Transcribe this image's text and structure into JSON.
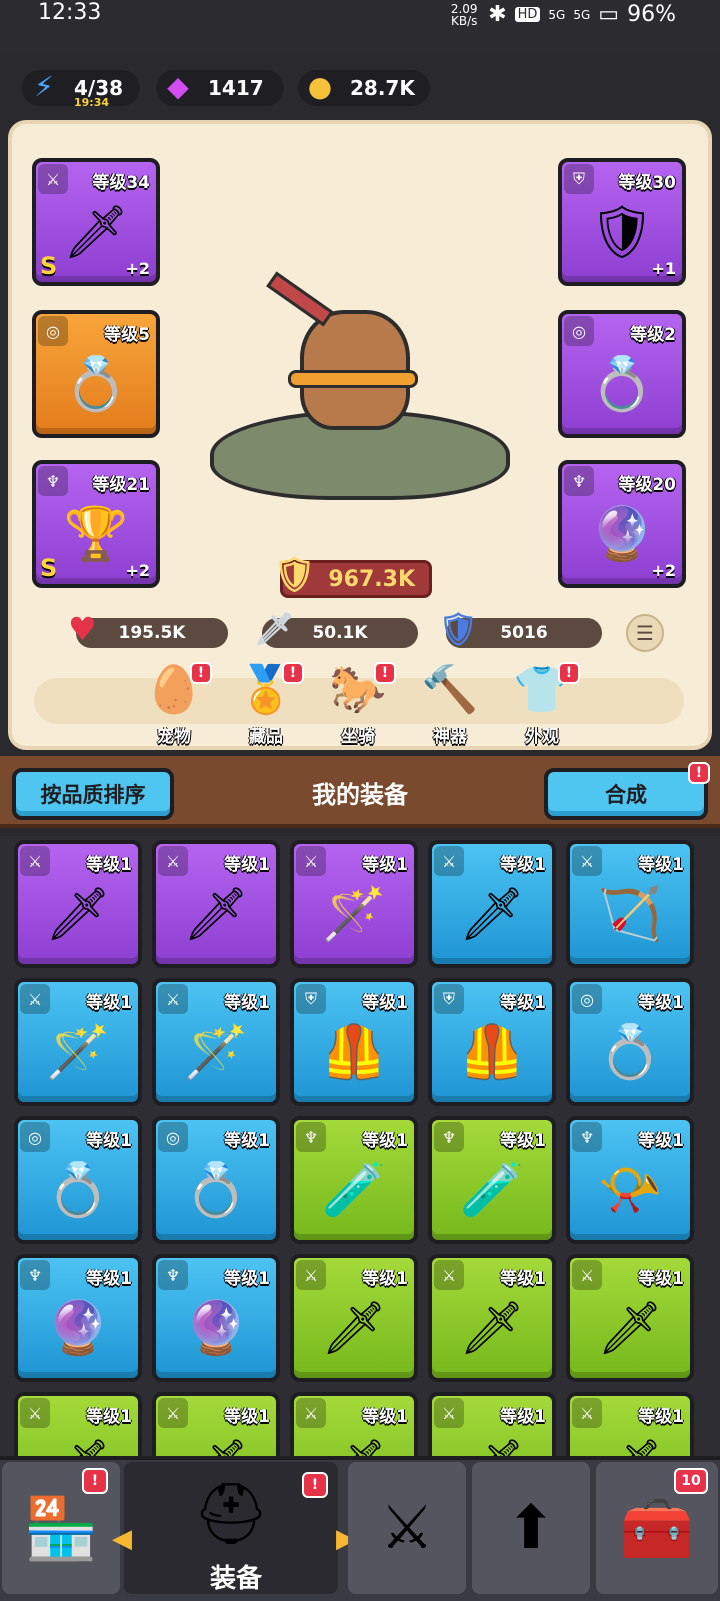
{
  "status_bar": {
    "time": "12:33",
    "net_speed": "2.09 KB/s",
    "signal_1": "5G",
    "signal_2": "5G",
    "battery": "96%"
  },
  "resources": {
    "energy": {
      "value": "4/38",
      "timer": "19:34",
      "icon": "lightning-icon"
    },
    "gems": {
      "value": "1417",
      "icon": "gem-icon"
    },
    "coins": {
      "value": "28.7K",
      "icon": "coin-icon"
    }
  },
  "equipped": [
    {
      "slot": "weapon",
      "level": "等级34",
      "plus": "+2",
      "grade": "S",
      "rarity": "purple",
      "icon": "sword-icon"
    },
    {
      "slot": "armor",
      "level": "等级30",
      "plus": "+1",
      "grade": "",
      "rarity": "purple",
      "icon": "armor-icon"
    },
    {
      "slot": "ring",
      "level": "等级5",
      "plus": "",
      "grade": "",
      "rarity": "orange",
      "icon": "ring-icon"
    },
    {
      "slot": "ring",
      "level": "等级2",
      "plus": "",
      "grade": "",
      "rarity": "purple",
      "icon": "ring-icon"
    },
    {
      "slot": "necklace",
      "level": "等级21",
      "plus": "+2",
      "grade": "S",
      "rarity": "purple",
      "icon": "chalice-icon"
    },
    {
      "slot": "necklace",
      "level": "等级20",
      "plus": "+2",
      "grade": "",
      "rarity": "purple",
      "icon": "orb-icon"
    }
  ],
  "power": "967.3K",
  "stats": {
    "hp": "195.5K",
    "attack": "50.1K",
    "defense": "5016"
  },
  "sub_tabs": [
    {
      "label": "宠物",
      "icon": "pet-egg-icon",
      "badge": "!"
    },
    {
      "label": "藏品",
      "icon": "collection-icon",
      "badge": "!"
    },
    {
      "label": "坐骑",
      "icon": "mount-icon",
      "badge": "!"
    },
    {
      "label": "神器",
      "icon": "hammer-icon",
      "badge": ""
    },
    {
      "label": "外观",
      "icon": "outfit-icon",
      "badge": "!"
    }
  ],
  "equipment_bar": {
    "sort_label": "按品质排序",
    "title": "我的装备",
    "merge_label": "合成",
    "merge_badge": "!"
  },
  "inventory": [
    {
      "level": "等级1",
      "rarity": "purple",
      "icon": "sword-icon",
      "tag": "sword"
    },
    {
      "level": "等级1",
      "rarity": "purple",
      "icon": "sword-icon",
      "tag": "sword"
    },
    {
      "level": "等级1",
      "rarity": "purple",
      "icon": "staff-icon",
      "tag": "sword"
    },
    {
      "level": "等级1",
      "rarity": "blue",
      "icon": "sword-icon",
      "tag": "sword"
    },
    {
      "level": "等级1",
      "rarity": "blue",
      "icon": "bow-icon",
      "tag": "sword"
    },
    {
      "level": "等级1",
      "rarity": "blue",
      "icon": "staff-icon",
      "tag": "sword"
    },
    {
      "level": "等级1",
      "rarity": "blue",
      "icon": "wand-icon",
      "tag": "sword"
    },
    {
      "level": "等级1",
      "rarity": "blue",
      "icon": "armor-icon",
      "tag": "armor"
    },
    {
      "level": "等级1",
      "rarity": "blue",
      "icon": "armor-icon",
      "tag": "armor"
    },
    {
      "level": "等级1",
      "rarity": "blue",
      "icon": "ring-icon",
      "tag": "ring"
    },
    {
      "level": "等级1",
      "rarity": "blue",
      "icon": "ring-icon",
      "tag": "ring"
    },
    {
      "level": "等级1",
      "rarity": "blue",
      "icon": "ring-icon",
      "tag": "ring"
    },
    {
      "level": "等级1",
      "rarity": "green",
      "icon": "potion-icon",
      "tag": "necklace"
    },
    {
      "level": "等级1",
      "rarity": "green",
      "icon": "potion-icon",
      "tag": "necklace"
    },
    {
      "level": "等级1",
      "rarity": "blue",
      "icon": "horn-icon",
      "tag": "necklace"
    },
    {
      "level": "等级1",
      "rarity": "blue",
      "icon": "orb-icon",
      "tag": "necklace"
    },
    {
      "level": "等级1",
      "rarity": "blue",
      "icon": "orb-icon",
      "tag": "necklace"
    },
    {
      "level": "等级1",
      "rarity": "green",
      "icon": "sword-icon",
      "tag": "sword"
    },
    {
      "level": "等级1",
      "rarity": "green",
      "icon": "sword-icon",
      "tag": "sword"
    },
    {
      "level": "等级1",
      "rarity": "green",
      "icon": "sword-icon",
      "tag": "sword"
    },
    {
      "level": "等级1",
      "rarity": "green",
      "icon": "sword-icon",
      "tag": "sword"
    },
    {
      "level": "等级1",
      "rarity": "green",
      "icon": "sword-icon",
      "tag": "sword"
    },
    {
      "level": "等级1",
      "rarity": "green",
      "icon": "sword-icon",
      "tag": "sword"
    },
    {
      "level": "等级1",
      "rarity": "green",
      "icon": "sword-icon",
      "tag": "sword"
    },
    {
      "level": "等级1",
      "rarity": "green",
      "icon": "sword-icon",
      "tag": "sword"
    }
  ],
  "bottom_nav": [
    {
      "label": "",
      "icon": "shop-icon",
      "badge": "!"
    },
    {
      "label": "装备",
      "icon": "helmet-icon",
      "badge": "!",
      "selected": true
    },
    {
      "label": "",
      "icon": "crossed-swords-icon",
      "badge": ""
    },
    {
      "label": "",
      "icon": "upgrade-icon",
      "badge": ""
    },
    {
      "label": "",
      "icon": "treasure-chest-icon",
      "badge": "10"
    }
  ],
  "colors": {
    "purple": "#9d4fe0",
    "orange": "#f0922c",
    "blue": "#2fa9e2",
    "green": "#8ccb2a",
    "panel": "#f7ecd6",
    "badge": "#e6334a"
  }
}
